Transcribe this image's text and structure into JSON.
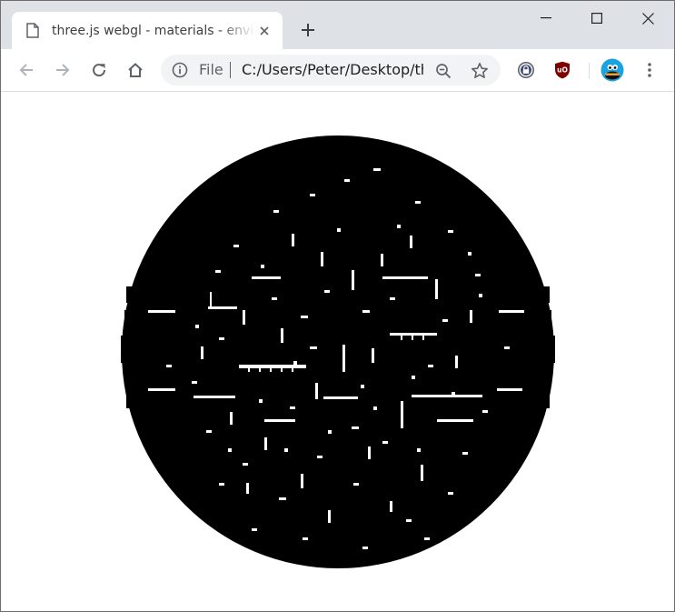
{
  "browser": {
    "tab": {
      "title": "three.js webgl - materials - environment maps",
      "favicon_icon": "page-icon",
      "close_icon": "close-icon"
    },
    "new_tab_icon": "plus-icon",
    "window_controls": [
      "minimize-icon",
      "maximize-icon",
      "close-icon"
    ],
    "toolbar": {
      "back_icon": "arrow-left-icon",
      "forward_icon": "arrow-right-icon",
      "reload_icon": "reload-icon",
      "home_icon": "home-icon"
    },
    "omnibox": {
      "security_icon": "info-icon",
      "scheme_chip": "File",
      "url": "C:/Users/Peter/Desktop/three.js/examples/webgl_materials_envmaps.html",
      "zoom_icon": "zoom-out-icon",
      "bookmark_icon": "star-icon"
    },
    "extensions": [
      "lock-extension-icon",
      "ublock-origin-icon",
      "profile-avatar-icon"
    ],
    "menu_icon": "kebab-menu-icon"
  },
  "colors": {
    "chrome_frame": "#dee1e6",
    "tab_active": "#ffffff",
    "omnibox_bg": "#f1f3f4",
    "icon_gray": "#5f6368",
    "ublock_red": "#800000",
    "avatar_blue": "#1aa3e0",
    "sphere": "#000000",
    "page_bg": "#ffffff"
  },
  "page": {
    "canvas_content": "black-sphere-with-white-glitch-artifacts"
  }
}
